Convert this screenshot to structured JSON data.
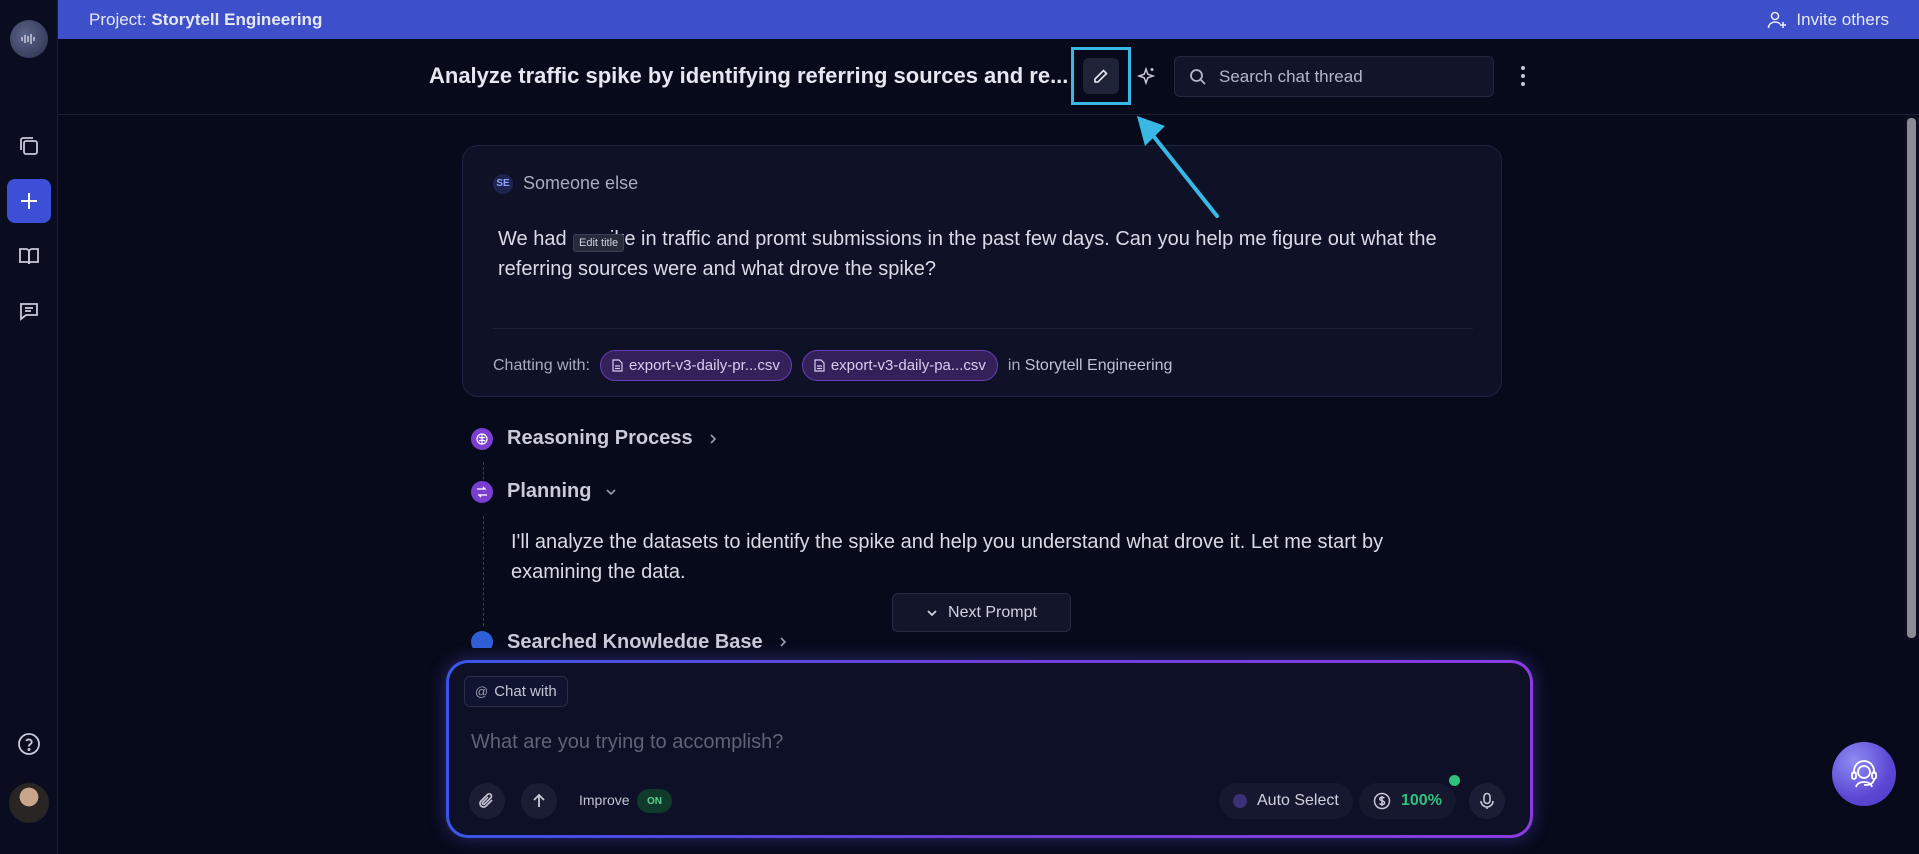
{
  "project_bar": {
    "prefix": "Project: ",
    "project_name": "Storytell Engineering",
    "invite_label": "Invite others"
  },
  "header": {
    "thread_title": "Analyze traffic spike by identifying referring sources and re...",
    "search_placeholder": "Search chat thread"
  },
  "message": {
    "sender_initials": "SE",
    "sender_name": "Someone else",
    "text": "We had a spike in traffic and promt submissions in the past few days. Can you help me figure out what the referring sources were and what drove the spike?",
    "tooltip": "Edit title",
    "chatting_label": "Chatting with:",
    "files": [
      "export-v3-daily-pr...csv",
      "export-v3-daily-pa...csv"
    ],
    "in_prefix": "in",
    "in_project": "Storytell Engineering"
  },
  "steps": {
    "reasoning": "Reasoning Process",
    "planning": "Planning",
    "planning_text": "I'll analyze the datasets to identify the spike and help you understand what drove it. Let me start by examining the data.",
    "searched": "Searched Knowledge Base"
  },
  "next_prompt": "Next Prompt",
  "composer": {
    "chat_with": "Chat with",
    "placeholder": "What are you trying to accomplish?",
    "improve_label": "Improve",
    "improve_state": "ON",
    "auto_select": "Auto Select",
    "credits": "100%"
  },
  "colors": {
    "project_bar": "#3d4fc9",
    "highlight": "#39b8e6",
    "chip_bg": "#34215a",
    "accent_green": "#2ec27e"
  }
}
